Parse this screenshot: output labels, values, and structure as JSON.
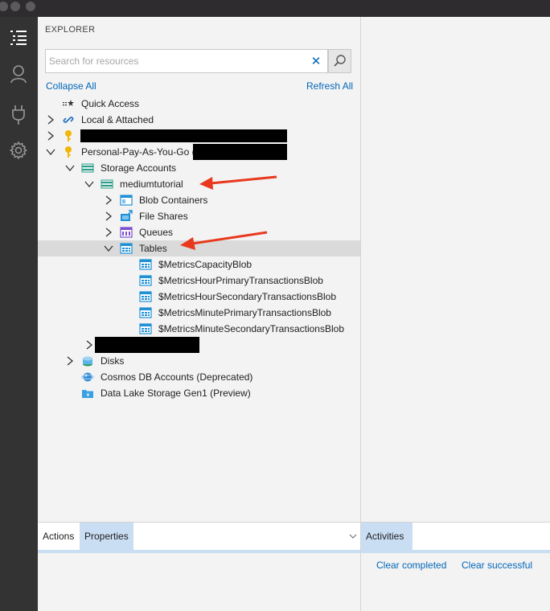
{
  "explorer": {
    "title": "EXPLORER",
    "search_placeholder": "Search for resources",
    "collapse_all": "Collapse All",
    "refresh_all": "Refresh All"
  },
  "tree": {
    "quick_access": "Quick Access",
    "local_attached": "Local & Attached",
    "subscription": "Personal-Pay-As-You-Go (",
    "storage_accounts": "Storage Accounts",
    "account": "mediumtutorial",
    "blob_containers": "Blob Containers",
    "file_shares": "File Shares",
    "queues": "Queues",
    "tables": "Tables",
    "table_items": [
      "$MetricsCapacityBlob",
      "$MetricsHourPrimaryTransactionsBlob",
      "$MetricsHourSecondaryTransactionsBlob",
      "$MetricsMinutePrimaryTransactionsBlob",
      "$MetricsMinuteSecondaryTransactionsBlob"
    ],
    "disks": "Disks",
    "cosmos": "Cosmos DB Accounts (Deprecated)",
    "datalake": "Data Lake Storage Gen1 (Preview)"
  },
  "bottom": {
    "tab_actions": "Actions",
    "tab_properties": "Properties",
    "tab_activities": "Activities",
    "clear_completed": "Clear completed",
    "clear_successful": "Clear successful"
  },
  "colors": {
    "accent": "#0066b8",
    "annotation_arrow": "#e8391e",
    "activity_bar": "#333333"
  }
}
